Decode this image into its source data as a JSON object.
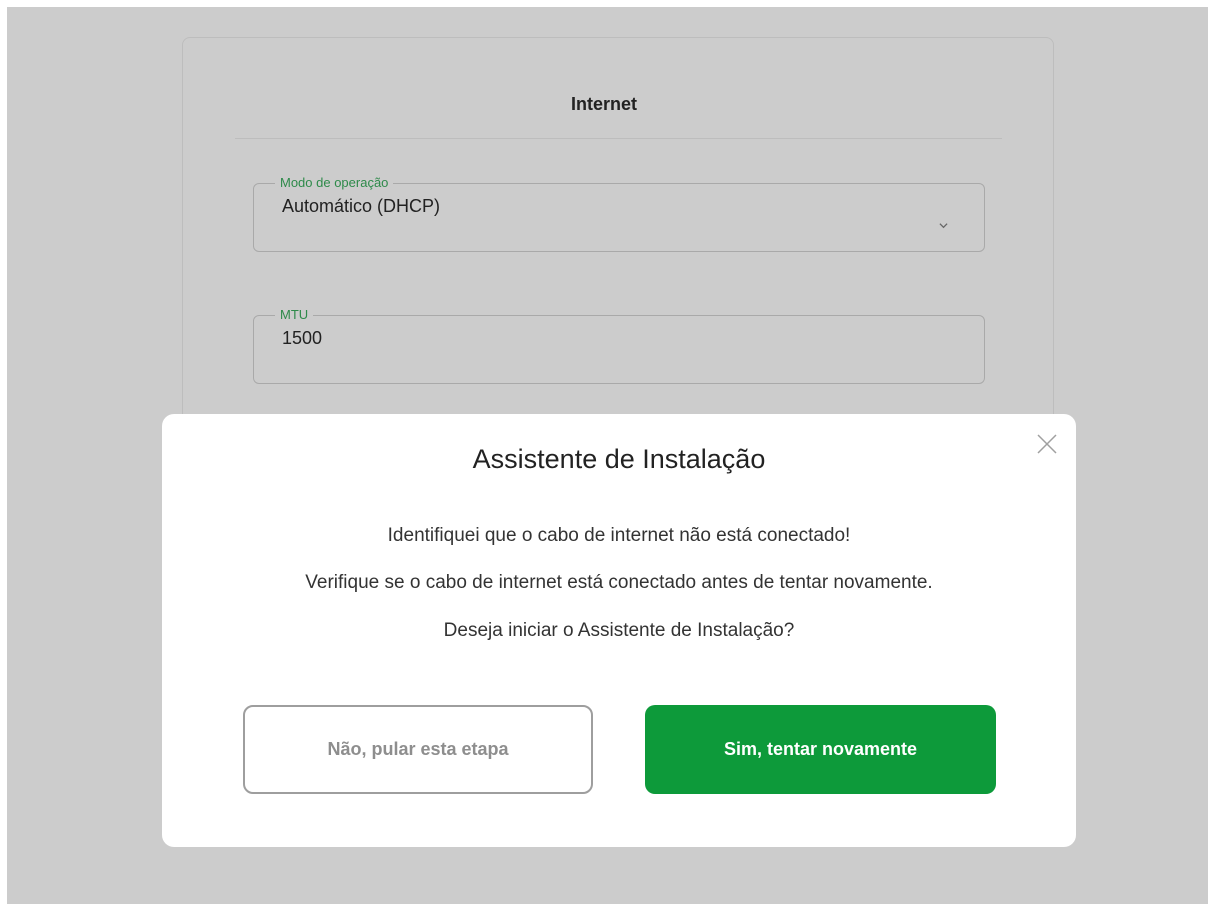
{
  "card": {
    "title": "Internet",
    "modo_label": "Modo de operação",
    "modo_value": "Automático (DHCP)",
    "mtu_label": "MTU",
    "mtu_value": "1500"
  },
  "modal": {
    "title": "Assistente de Instalação",
    "line1": "Identifiquei que o cabo de internet não está conectado!",
    "line2": "Verifique se o cabo de internet está conectado antes de tentar novamente.",
    "line3": "Deseja iniciar o Assistente de Instalação?",
    "skip_label": "Não, pular esta etapa",
    "retry_label": "Sim, tentar novamente",
    "close_icon": "close-icon"
  },
  "colors": {
    "backdrop": "#cccccc",
    "accent_green": "#0d9a3a",
    "legend_green": "#2e8a4a"
  }
}
